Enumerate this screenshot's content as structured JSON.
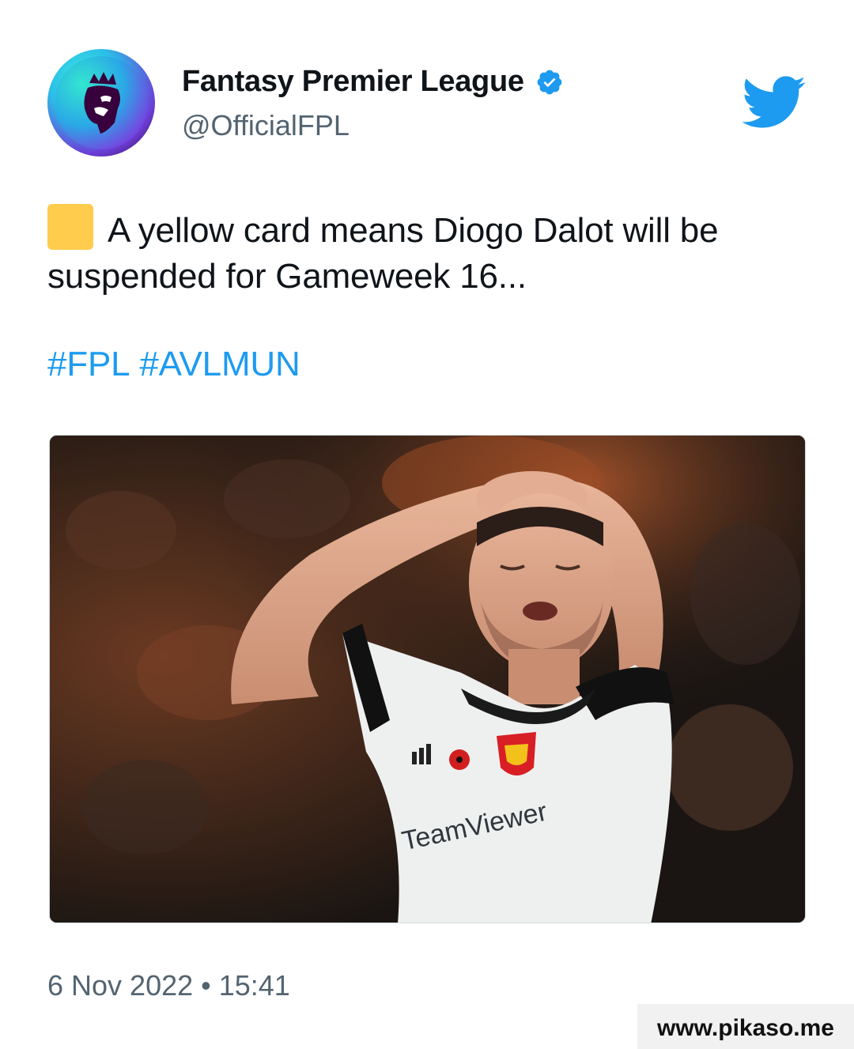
{
  "account": {
    "display_name": "Fantasy Premier League",
    "handle": "@OfficialFPL",
    "verified": true
  },
  "tweet": {
    "emoji": "yellow-square",
    "text": "A yellow card means Diogo Dalot will be suspended for Gameweek 16...",
    "hashtags": [
      "#FPL",
      "#AVLMUN"
    ],
    "timestamp": "6 Nov 2022 • 15:41"
  },
  "photo": {
    "sponsor_text": "TeamViewer",
    "kit_brand": "adidas"
  },
  "icons": {
    "avatar": "premier-league-lion-icon",
    "verified": "verified-badge-icon",
    "brand": "twitter-bird-icon"
  },
  "colors": {
    "link": "#1d9bf0",
    "twitter_blue": "#1d9bf0",
    "secondary_text": "#536471",
    "yellow_card": "#ffcc4d"
  },
  "watermark": "www.pikaso.me"
}
